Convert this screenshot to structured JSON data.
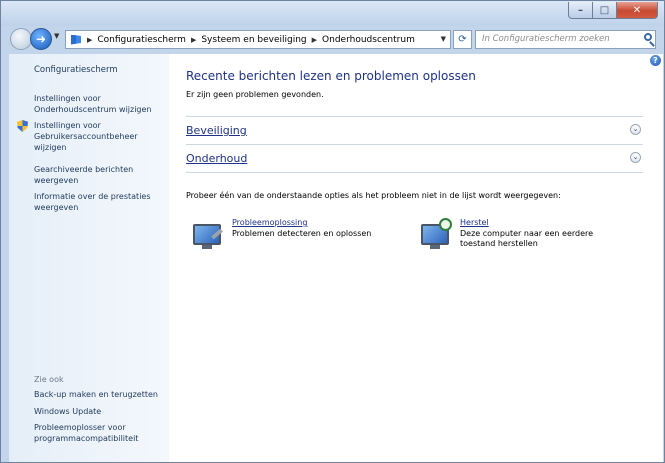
{
  "window": {
    "controls": {
      "minimize": "–",
      "maximize": "□",
      "close": "✕"
    }
  },
  "address_bar": {
    "breadcrumbs": [
      "Configuratiescherm",
      "Systeem en beveiliging",
      "Onderhoudscentrum"
    ],
    "search_placeholder": "In Configuratiescherm zoeken"
  },
  "sidebar": {
    "heading": "Configuratiescherm",
    "links": [
      "Instellingen voor Onderhoudscentrum wijzigen",
      "Instellingen voor Gebruikersaccountbeheer wijzigen",
      "Gearchiveerde berichten weergeven",
      "Informatie over de prestaties weergeven"
    ],
    "see_also_heading": "Zie ook",
    "see_also_links": [
      "Back-up maken en terugzetten",
      "Windows Update",
      "Probleemoplosser voor programmacompatibiliteit"
    ]
  },
  "main": {
    "title": "Recente berichten lezen en problemen oplossen",
    "status": "Er zijn geen problemen gevonden.",
    "sections": [
      "Beveiliging",
      "Onderhoud"
    ],
    "prompt": "Probeer één van de onderstaande opties als het probleem niet in de lijst wordt weergegeven:",
    "tools": [
      {
        "title": "Probleemoplossing",
        "description": "Problemen detecteren en oplossen"
      },
      {
        "title": "Herstel",
        "description": "Deze computer naar een eerdere toestand herstellen"
      }
    ]
  },
  "colors": {
    "link": "#1e3287",
    "sidebar_text": "#1e395b",
    "window_frame": "#c3d5ea"
  }
}
